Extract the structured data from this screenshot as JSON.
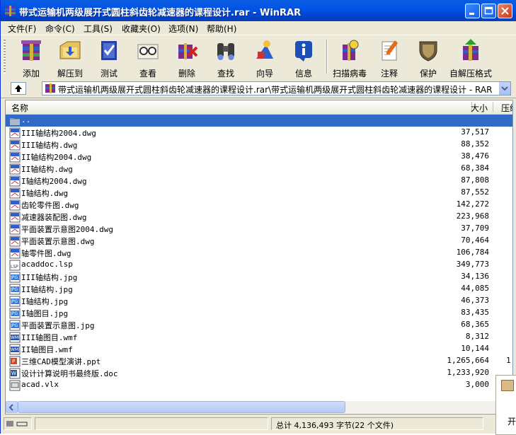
{
  "window": {
    "title": "带式运输机两级展开式圆柱斜齿轮减速器的课程设计.rar - WinRAR"
  },
  "menu": [
    "文件(F)",
    "命令(C)",
    "工具(S)",
    "收藏夹(O)",
    "选项(N)",
    "帮助(H)"
  ],
  "toolbar": {
    "add": "添加",
    "extract": "解压到",
    "test": "测试",
    "view": "查看",
    "delete": "删除",
    "find": "查找",
    "wizard": "向导",
    "info": "信息",
    "virus": "扫描病毒",
    "comment": "注释",
    "protect": "保护",
    "sfx": "自解压格式"
  },
  "address": {
    "path": "带式运输机两级展开式圆柱斜齿轮减速器的课程设计.rar\\带式运输机两级展开式圆柱斜齿轮减速器的课程设计 - RAR"
  },
  "columns": {
    "name": "名称",
    "size": "大小",
    "packed": "压缩"
  },
  "files": [
    {
      "name": "..",
      "size": "",
      "packed": "",
      "type": "folder-up"
    },
    {
      "name": "III轴结构2004.dwg",
      "size": "37,517",
      "packed": "",
      "type": "dwg"
    },
    {
      "name": "III轴结构.dwg",
      "size": "88,352",
      "packed": "",
      "type": "dwg"
    },
    {
      "name": "II轴结构2004.dwg",
      "size": "38,476",
      "packed": "",
      "type": "dwg"
    },
    {
      "name": "II轴结构.dwg",
      "size": "68,384",
      "packed": "",
      "type": "dwg"
    },
    {
      "name": "I轴结构2004.dwg",
      "size": "87,808",
      "packed": "",
      "type": "dwg"
    },
    {
      "name": "I轴结构.dwg",
      "size": "87,552",
      "packed": "",
      "type": "dwg"
    },
    {
      "name": "齿轮零件图.dwg",
      "size": "142,272",
      "packed": "",
      "type": "dwg"
    },
    {
      "name": "减速器装配图.dwg",
      "size": "223,968",
      "packed": "",
      "type": "dwg"
    },
    {
      "name": "平面装置示意图2004.dwg",
      "size": "37,709",
      "packed": "",
      "type": "dwg"
    },
    {
      "name": "平面装置示意图.dwg",
      "size": "70,464",
      "packed": "",
      "type": "dwg"
    },
    {
      "name": "轴零件图.dwg",
      "size": "106,784",
      "packed": "",
      "type": "dwg"
    },
    {
      "name": "acaddoc.lsp",
      "size": "349,773",
      "packed": "",
      "type": "lsp"
    },
    {
      "name": "III轴结构.jpg",
      "size": "34,136",
      "packed": "",
      "type": "jpg"
    },
    {
      "name": "II轴结构.jpg",
      "size": "44,085",
      "packed": "",
      "type": "jpg"
    },
    {
      "name": "I轴结构.jpg",
      "size": "46,373",
      "packed": "",
      "type": "jpg"
    },
    {
      "name": "I轴图目.jpg",
      "size": "83,435",
      "packed": "",
      "type": "jpg"
    },
    {
      "name": "平面装置示意图.jpg",
      "size": "68,365",
      "packed": "",
      "type": "jpg"
    },
    {
      "name": "III轴图目.wmf",
      "size": "8,312",
      "packed": "",
      "type": "wmf"
    },
    {
      "name": "II轴图目.wmf",
      "size": "10,144",
      "packed": "",
      "type": "wmf"
    },
    {
      "name": "三维CAD模型演讲.ppt",
      "size": "1,265,664",
      "packed": "1,",
      "type": "ppt"
    },
    {
      "name": "设计计算说明书最终版.doc",
      "size": "1,233,920",
      "packed": "",
      "type": "doc"
    },
    {
      "name": "acad.vlx",
      "size": "3,000",
      "packed": "",
      "type": "vlx"
    }
  ],
  "status": {
    "total": "总计 4,136,493 字节(22 个文件)"
  },
  "popup": {
    "text": "开"
  },
  "colors": {
    "title_bar": "#0154e5",
    "selection": "#316ac5"
  }
}
